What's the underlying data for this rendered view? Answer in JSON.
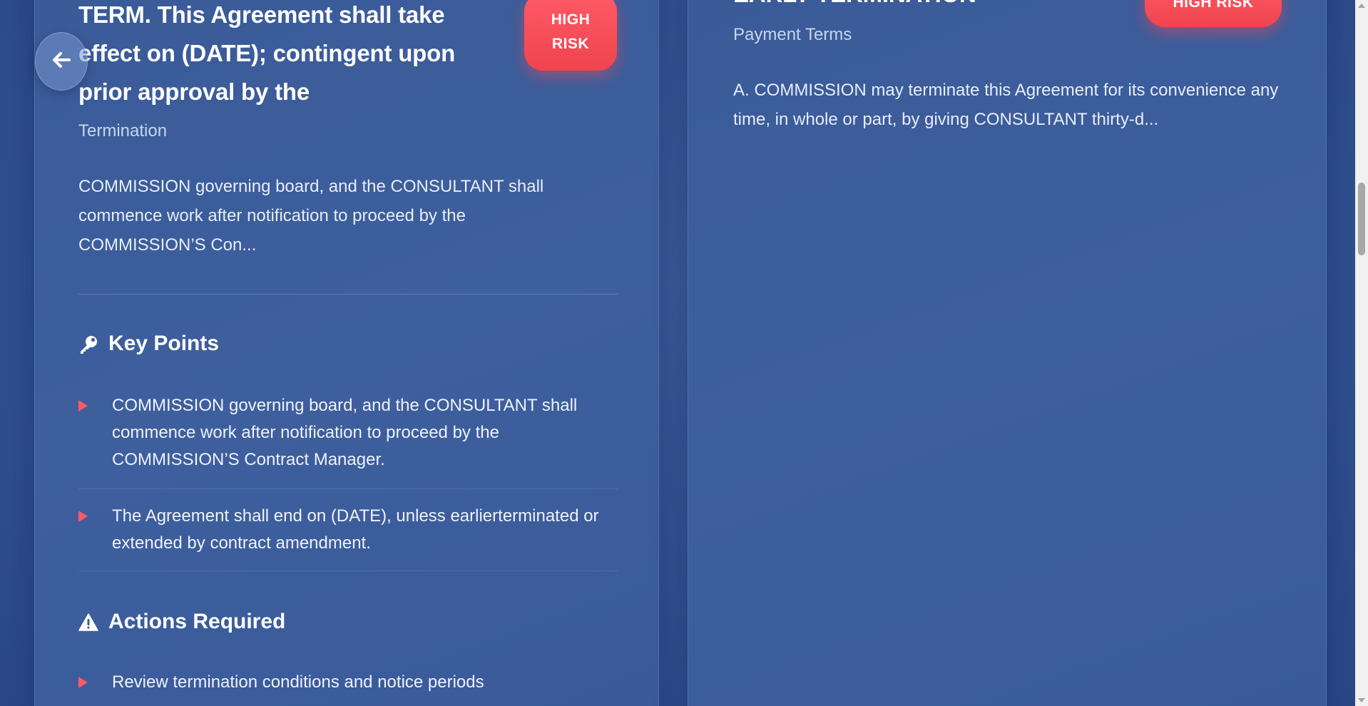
{
  "left_card": {
    "title_lines": [
      "TERM. This Agreement shall take",
      "effect on (DATE); contingent upon",
      "prior approval by the"
    ],
    "risk_badge_lines": [
      "HIGH",
      "RISK"
    ],
    "category": "Termination",
    "excerpt": "COMMISSION governing board, and the CONSULTANT shall commence work after notification to proceed by the COMMISSION’S Con...",
    "key_points": {
      "heading": "Key Points",
      "icon": "key-icon",
      "items": [
        "COMMISSION governing board, and the CONSULTANT shall commence work after notification to proceed by the COMMISSION’S Contract Manager.",
        "The Agreement shall end on (DATE), unless earlierterminated or extended by contract amendment."
      ]
    },
    "actions_required": {
      "heading": "Actions Required",
      "icon": "warning-icon",
      "items": [
        "Review termination conditions and notice periods"
      ]
    }
  },
  "right_card": {
    "title": "EARLY TERMINATION",
    "risk_badge": "HIGH RISK",
    "category": "Payment Terms",
    "excerpt": "A. COMMISSION may terminate this Agreement for its convenience any time, in whole or part, by giving CONSULTANT thirty-d..."
  },
  "back_button": {
    "icon": "arrow-left-icon"
  },
  "colors": {
    "background": "#2f4f8f",
    "card": "#3c5c9a",
    "risk_badge": "#f24a55",
    "bullet_marker": "#ff5a66",
    "text_primary": "#ffffff"
  }
}
